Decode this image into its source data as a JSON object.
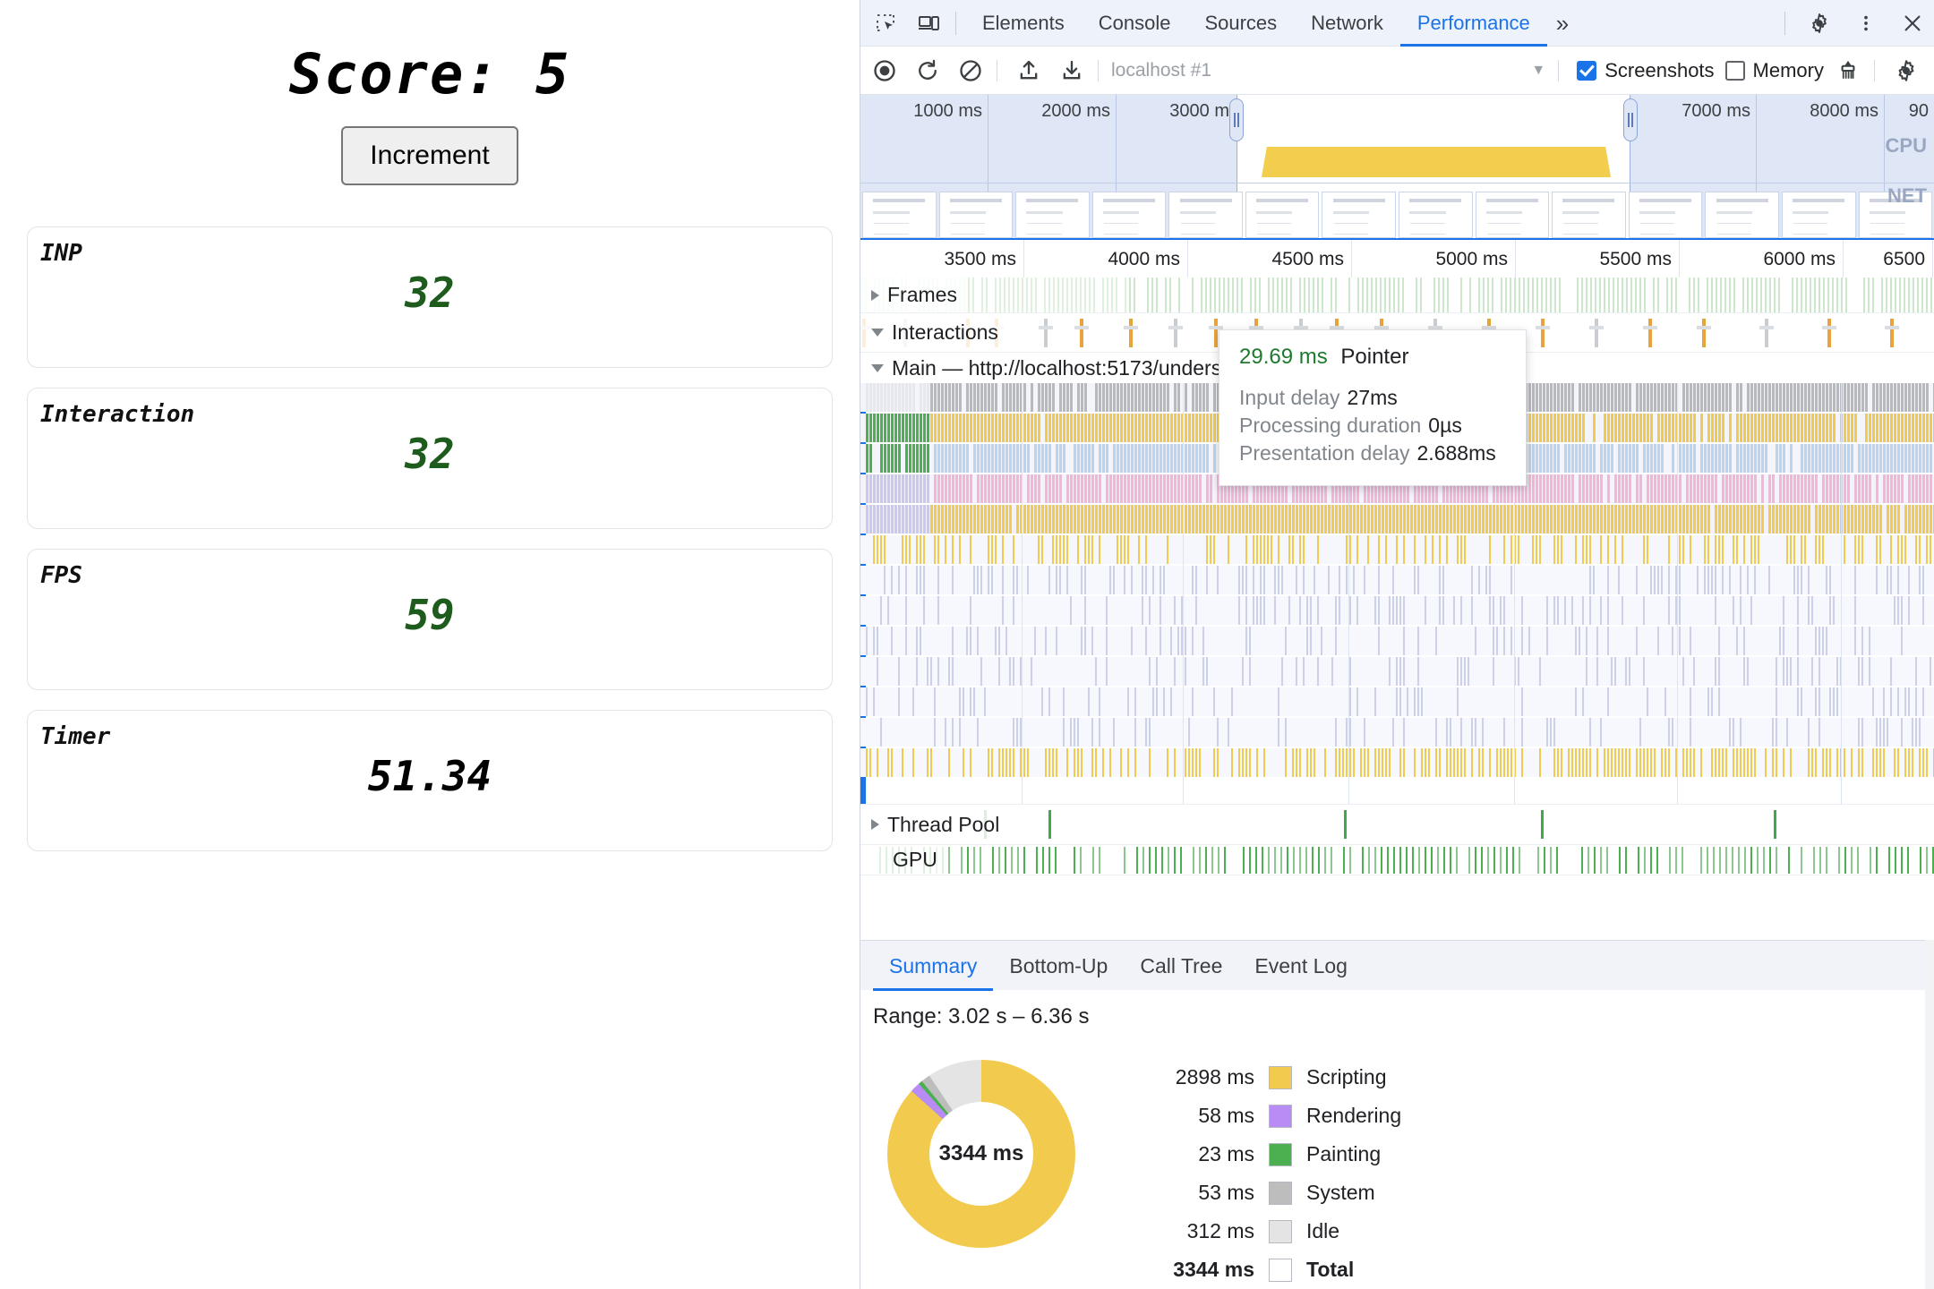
{
  "app": {
    "score_label": "Score: 5",
    "increment_button": "Increment",
    "cards": [
      {
        "label": "INP",
        "value": "32",
        "tone": "green"
      },
      {
        "label": "Interaction",
        "value": "32",
        "tone": "green"
      },
      {
        "label": "FPS",
        "value": "59",
        "tone": "green"
      },
      {
        "label": "Timer",
        "value": "51.34",
        "tone": "dark"
      }
    ]
  },
  "devtools": {
    "tabs": [
      {
        "label": "Elements",
        "active": false
      },
      {
        "label": "Console",
        "active": false
      },
      {
        "label": "Sources",
        "active": false
      },
      {
        "label": "Network",
        "active": false
      },
      {
        "label": "Performance",
        "active": true
      }
    ],
    "more_tabs_glyph": "»",
    "icons": {
      "inspect": "inspect-element-icon",
      "device": "device-toolbar-icon",
      "settings": "gear-icon",
      "menu": "kebab-menu-icon",
      "close": "close-icon",
      "record": "record-icon",
      "reload": "reload-and-record-icon",
      "clear": "clear-icon",
      "upload": "upload-profile-icon",
      "download": "download-profile-icon",
      "trash": "collect-garbage-icon",
      "capture_settings": "capture-settings-gear-icon"
    },
    "toolbar": {
      "recording_name": "localhost #1",
      "screenshots_label": "Screenshots",
      "screenshots_checked": true,
      "memory_label": "Memory",
      "memory_checked": false
    },
    "overview": {
      "ticks": [
        "1000 ms",
        "2000 ms",
        "3000 ms",
        "4000 ms",
        "5000 ms",
        "6000 ms",
        "7000 ms",
        "8000 ms",
        "90"
      ],
      "cpu_label": "CPU",
      "net_label": "NET"
    },
    "main_ruler": {
      "ticks": [
        "3500 ms",
        "4000 ms",
        "4500 ms",
        "5000 ms",
        "5500 ms",
        "6000 ms",
        "6500"
      ]
    },
    "tracks": [
      {
        "name": "Frames",
        "expanded": false
      },
      {
        "name": "Interactions",
        "expanded": true
      },
      {
        "name": "Main — http://localhost:5173/unders",
        "expanded": true
      },
      {
        "name": "Thread Pool",
        "expanded": false
      },
      {
        "name": "GPU",
        "expanded": null
      }
    ],
    "tooltip": {
      "duration": "29.69 ms",
      "title": "Pointer",
      "rows": [
        {
          "label": "Input delay",
          "value": "27ms"
        },
        {
          "label": "Processing duration",
          "value": "0µs"
        },
        {
          "label": "Presentation delay",
          "value": "2.688ms"
        }
      ]
    },
    "bottom_tabs": [
      {
        "label": "Summary",
        "active": true
      },
      {
        "label": "Bottom-Up",
        "active": false
      },
      {
        "label": "Call Tree",
        "active": false
      },
      {
        "label": "Event Log",
        "active": false
      }
    ],
    "summary": {
      "range": "Range: 3.02 s – 6.36 s",
      "donut_center": "3344 ms"
    },
    "colors": {
      "accent": "#1a73e8",
      "scripting": "#f2cb4e",
      "rendering": "#b98cf5",
      "painting": "#4caf50",
      "system": "#bdbdbd",
      "idle": "#e4e4e4",
      "metric_green": "#1e5c1e"
    }
  },
  "chart_data": {
    "type": "pie",
    "title": "Summary",
    "center_label": "3344 ms",
    "categories": [
      "Scripting",
      "Rendering",
      "Painting",
      "System",
      "Idle"
    ],
    "values": [
      2898,
      58,
      23,
      53,
      312
    ],
    "unit": "ms",
    "colors": [
      "#f2cb4e",
      "#b98cf5",
      "#4caf50",
      "#bdbdbd",
      "#e4e4e4"
    ],
    "total_label": "Total",
    "total_value": 3344,
    "legend_position": "right",
    "rows": [
      {
        "value": "2898 ms",
        "name": "Scripting",
        "color": "#f2cb4e"
      },
      {
        "value": "58 ms",
        "name": "Rendering",
        "color": "#b98cf5"
      },
      {
        "value": "23 ms",
        "name": "Painting",
        "color": "#4caf50"
      },
      {
        "value": "53 ms",
        "name": "System",
        "color": "#bdbdbd"
      },
      {
        "value": "312 ms",
        "name": "Idle",
        "color": "#e4e4e4"
      },
      {
        "value": "3344 ms",
        "name": "Total",
        "color": "#ffffff"
      }
    ]
  }
}
